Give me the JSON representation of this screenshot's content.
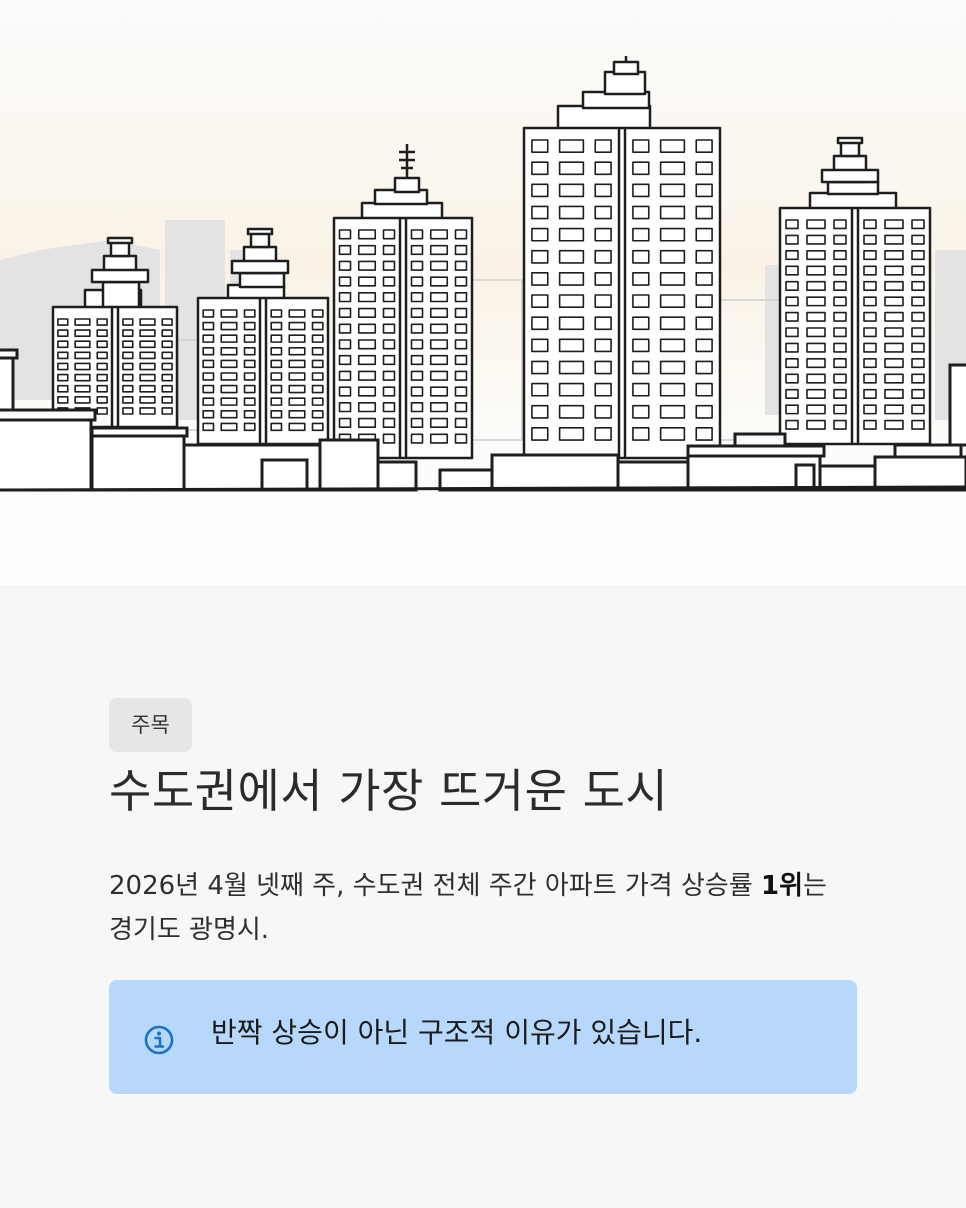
{
  "hero": {
    "illustration": "city-skyline-apartment-buildings"
  },
  "article": {
    "tag": "주목",
    "title": "수도권에서 가장 뜨거운 도시",
    "description_part1": "2026년 4월 넷째 주, 수도권 전체 주간 아파트 가격 상승률 ",
    "description_bold": "1위",
    "description_part2": "는 경기도 광명시."
  },
  "callout": {
    "icon": "info-icon",
    "message": "반짝 상승이 아닌 구조적 이유가 있습니다.",
    "background_color": "#b7d8fb",
    "icon_color": "#1a73c8"
  }
}
